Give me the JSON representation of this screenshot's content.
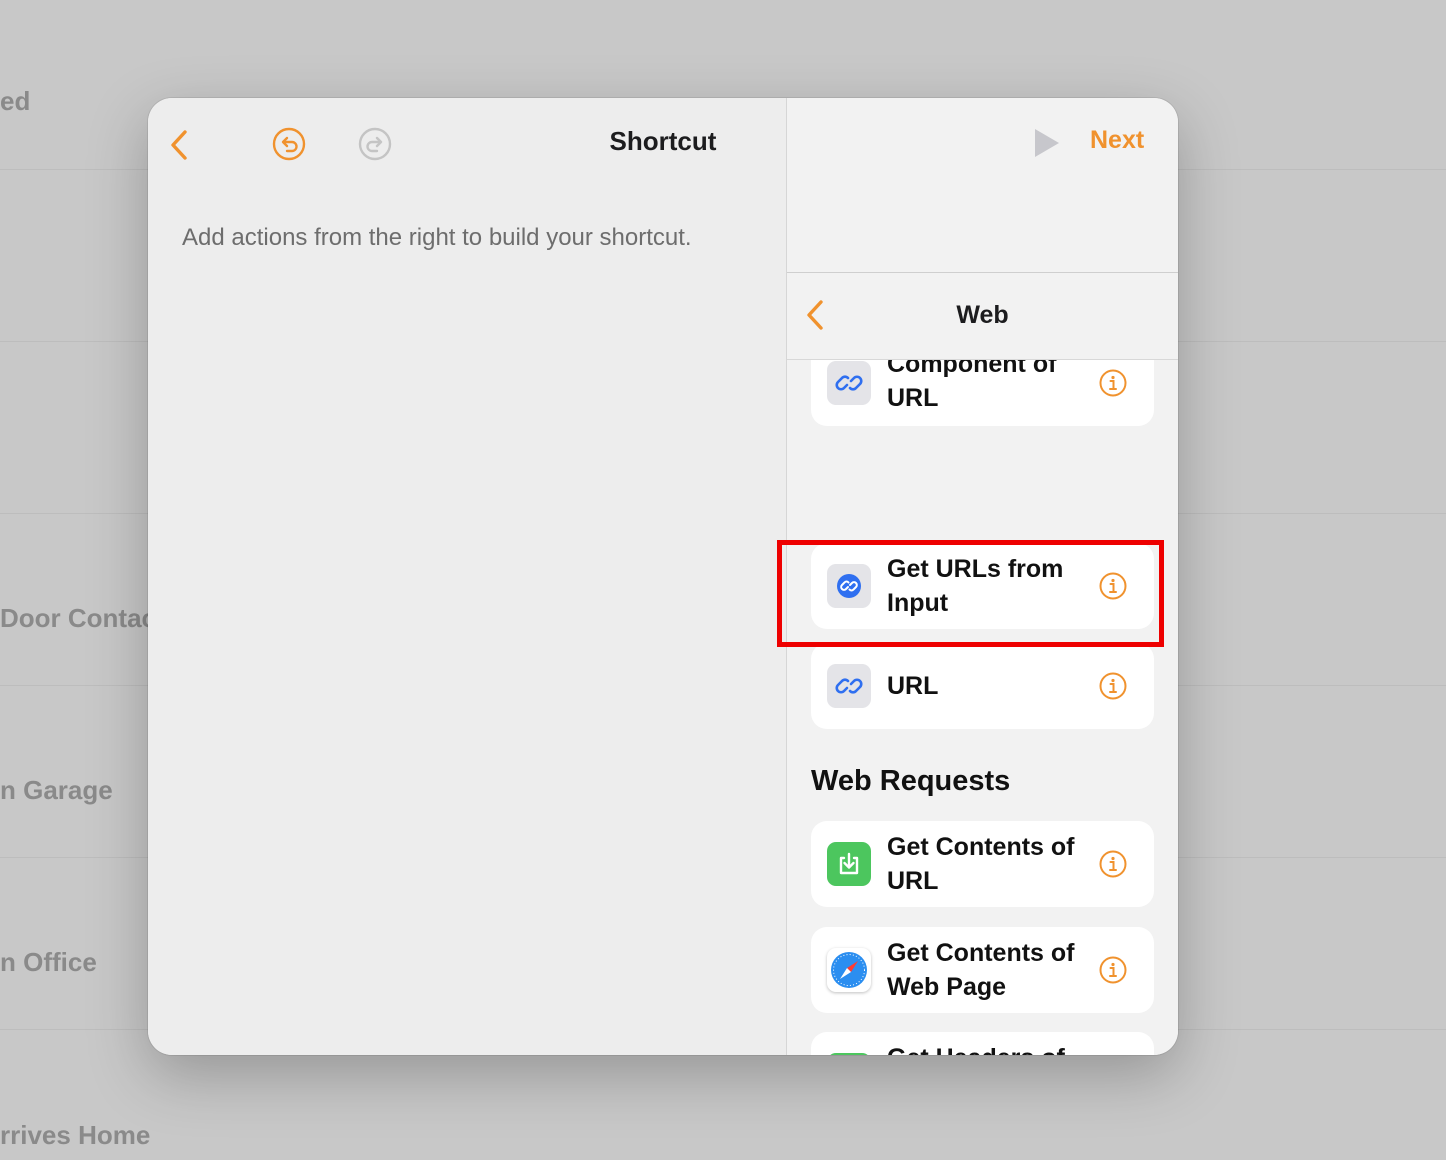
{
  "background": {
    "rows": [
      {
        "label": "ed"
      },
      {
        "label": "Door Contac"
      },
      {
        "label": "n Garage"
      },
      {
        "label": "n Office"
      },
      {
        "label": "rrives Home"
      }
    ]
  },
  "editor": {
    "title": "Shortcut",
    "empty_hint": "Add actions from the right to build your shortcut.",
    "toolbar": {
      "back_icon": "chevron-left-icon",
      "undo_icon": "undo-icon",
      "redo_icon": "redo-icon"
    }
  },
  "sidebar": {
    "run_icon": "play-icon",
    "next_label": "Next",
    "header": {
      "title": "Web",
      "back_icon": "chevron-left-icon"
    },
    "url_actions": [
      {
        "label": "Component of URL",
        "icon": "link-icon"
      },
      {
        "label": "Get URLs from Input",
        "icon": "link-icon"
      },
      {
        "label": "URL",
        "icon": "link-icon"
      }
    ],
    "web_requests_title": "Web Requests",
    "web_requests": [
      {
        "label": "Get Contents of URL",
        "icon": "download-icon"
      },
      {
        "label": "Get Contents of Web Page",
        "icon": "safari-icon"
      },
      {
        "label": "Get Headers of URL",
        "icon": "download-icon"
      }
    ]
  },
  "colors": {
    "accent": "#f0922e",
    "highlight": "#ee0000",
    "link_blue": "#2f6ff0",
    "green": "#4cc65e"
  }
}
